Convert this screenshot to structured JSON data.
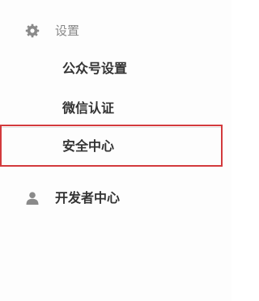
{
  "sidebar": {
    "settings": {
      "label": "设置",
      "icon": "gear-icon",
      "items": [
        {
          "label": "公众号设置"
        },
        {
          "label": "微信认证"
        },
        {
          "label": "安全中心"
        }
      ]
    },
    "developer": {
      "label": "开发者中心",
      "icon": "user-icon"
    },
    "highlight_color": "#d33a3d"
  }
}
